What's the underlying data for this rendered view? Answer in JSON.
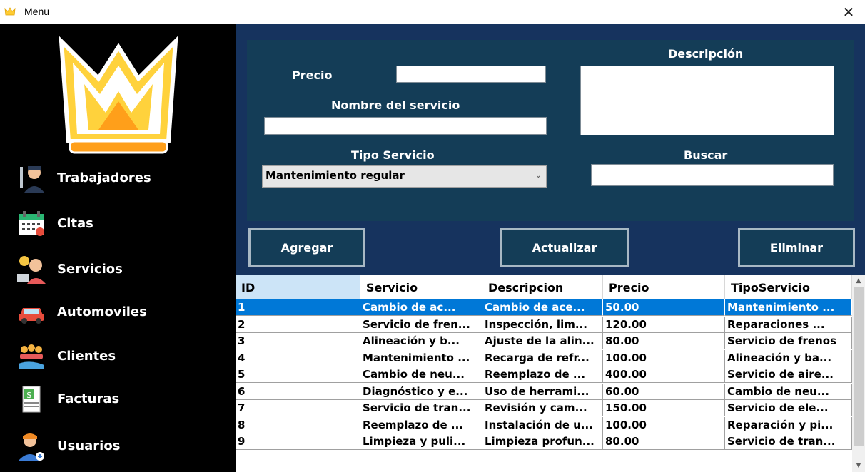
{
  "window": {
    "title": "Menu",
    "close_glyph": "✕"
  },
  "sidebar": {
    "logo": "crown-logo-icon",
    "items": [
      {
        "label": "Trabajadores",
        "icon": "mechanic-icon"
      },
      {
        "label": "Citas",
        "icon": "calendar-icon"
      },
      {
        "label": "Servicios",
        "icon": "support-agent-icon"
      },
      {
        "label": "Automoviles",
        "icon": "car-icon"
      },
      {
        "label": "Clientes",
        "icon": "clients-icon"
      },
      {
        "label": "Facturas",
        "icon": "invoice-icon"
      },
      {
        "label": "Usuarios",
        "icon": "add-user-icon"
      }
    ]
  },
  "form": {
    "precio_label": "Precio",
    "precio_value": "",
    "nombre_label": "Nombre del servicio",
    "nombre_value": "",
    "descripcion_label": "Descripción",
    "descripcion_value": "",
    "tipo_label": "Tipo Servicio",
    "tipo_value": "Mantenimiento regular",
    "buscar_label": "Buscar",
    "buscar_value": ""
  },
  "buttons": {
    "agregar": "Agregar",
    "actualizar": "Actualizar",
    "eliminar": "Eliminar"
  },
  "table": {
    "columns": [
      "ID",
      "Servicio",
      "Descripcion",
      "Precio",
      "TipoServicio"
    ],
    "rows": [
      [
        "1",
        "Cambio de ac...",
        "Cambio de ace...",
        "50.00",
        "Mantenimiento ..."
      ],
      [
        "2",
        "Servicio de fren...",
        "Inspección, lim...",
        "120.00",
        "Reparaciones ..."
      ],
      [
        "3",
        "Alineación y b...",
        "Ajuste de la alin...",
        "80.00",
        "Servicio de frenos"
      ],
      [
        "4",
        "Mantenimiento ...",
        "Recarga de refr...",
        "100.00",
        "Alineación y ba..."
      ],
      [
        "5",
        "Cambio de neu...",
        "Reemplazo de ...",
        "400.00",
        "Servicio de aire..."
      ],
      [
        "6",
        "Diagnóstico y e...",
        "Uso de herrami...",
        "60.00",
        "Cambio de neu..."
      ],
      [
        "7",
        "Servicio de tran...",
        "Revisión y cam...",
        "150.00",
        "Servicio de ele..."
      ],
      [
        "8",
        "Reemplazo de ...",
        "Instalación de u...",
        "100.00",
        "Reparación y pi..."
      ],
      [
        "9",
        "Limpieza y puli...",
        "Limpieza profun...",
        "80.00",
        "Servicio de tran..."
      ]
    ],
    "selected_row": 0
  },
  "colors": {
    "sidebar_bg": "#000000",
    "main_bg": "#16335e",
    "panel_bg": "#143d57",
    "selection": "#0078d7",
    "logo_yellow": "#ffd23c",
    "logo_orange": "#ff9f1a"
  }
}
